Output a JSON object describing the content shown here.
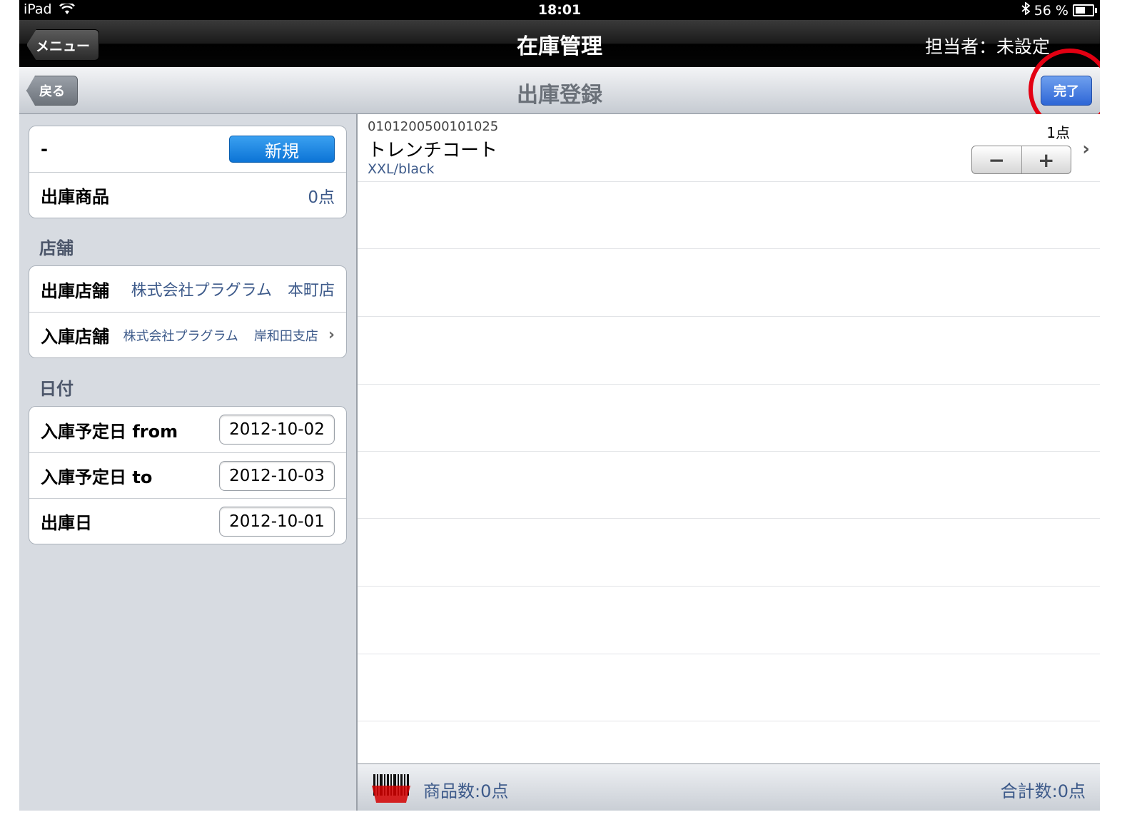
{
  "status_bar": {
    "carrier": "iPad",
    "time": "18:01",
    "battery": "56 %"
  },
  "nav": {
    "menu_label": "メニュー",
    "title": "在庫管理",
    "user": "担当者：未設定"
  },
  "subnav": {
    "back_label": "戻る",
    "title": "出庫登録",
    "done_label": "完了"
  },
  "summary": {
    "status_label": "-",
    "new_button": "新規",
    "items_label": "出庫商品",
    "items_value": "0点"
  },
  "store_section": {
    "title": "店舗",
    "out_label": "出庫店舗",
    "out_company": "株式会社プラグラム",
    "out_branch": "本町店",
    "in_label": "入庫店舗",
    "in_company": "株式会社プラグラム",
    "in_branch": "岸和田支店"
  },
  "date_section": {
    "title": "日付",
    "rows": [
      {
        "label": "入庫予定日 from",
        "value": "2012-10-02"
      },
      {
        "label": "入庫予定日 to",
        "value": "2012-10-03"
      },
      {
        "label": "出庫日",
        "value": "2012-10-01"
      }
    ]
  },
  "item": {
    "code": "0101200500101025",
    "name": "トレンチコート",
    "variant": "XXL/black",
    "qty": "1点",
    "minus": "−",
    "plus": "+"
  },
  "footer": {
    "product_count": "商品数:0点",
    "total_count": "合計数:0点"
  }
}
